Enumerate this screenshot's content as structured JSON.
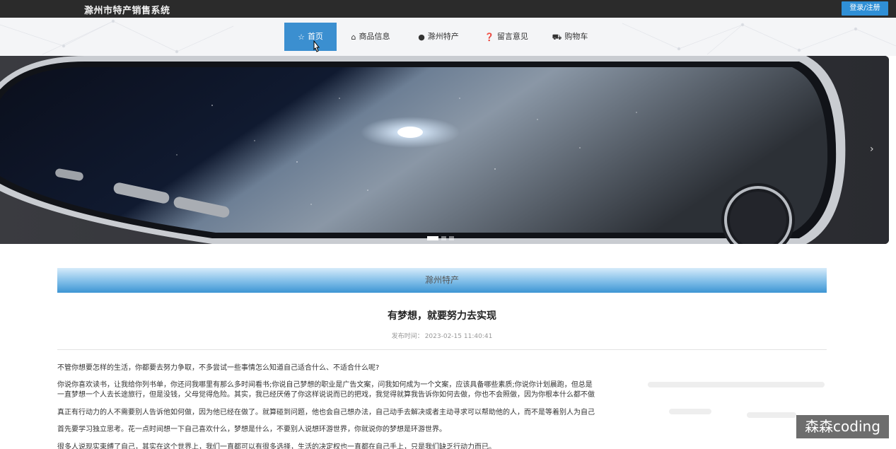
{
  "header": {
    "site_title": "滁州市特产销售系统",
    "login_label": "登录/注册"
  },
  "nav": {
    "items": [
      {
        "label": "首页",
        "icon": "star-icon",
        "active": true
      },
      {
        "label": "商品信息",
        "icon": "bag-icon",
        "active": false
      },
      {
        "label": "滁州特产",
        "icon": "info-icon",
        "active": false
      },
      {
        "label": "留言意见",
        "icon": "question-icon",
        "active": false
      },
      {
        "label": "购物车",
        "icon": "cart-icon",
        "active": false
      }
    ]
  },
  "banner": {
    "next_glyph": "›",
    "slide_count": 3,
    "active_slide": 1
  },
  "section": {
    "title": "滁州特产"
  },
  "article": {
    "title": "有梦想，就要努力去实现",
    "meta_label": "发布时间：",
    "published": "2023-02-15 11:40:41",
    "paragraphs": [
      "不管你想要怎样的生活，你都要去努力争取，不多尝试一些事情怎么知道自己适合什么、不适合什么呢?",
      "你说你喜欢读书，让我给你列书单，你还问我哪里有那么多时间看书;你说自己梦想的职业是广告文案，问我如何成为一个文案，应该具备哪些素质;你说你计划晨跑，但总是",
      "一直梦想一个人去长途旅行，但是没钱，父母觉得危险。其实，我已经厌倦了你这样说说而已的把戏，我觉得就算我告诉你如何去做，你也不会照做，因为你根本什么都不做",
      "真正有行动力的人不需要别人告诉他如何做，因为他已经在做了。就算碰到问题，他也会自己想办法，自己动手去解决或者主动寻求可以帮助他的人，而不是等着别人为自己",
      "首先要学习独立思考。花一点时间想一下自己喜欢什么，梦想是什么，不要别人说想环游世界，你就说你的梦想是环游世界。",
      "很多人说现实束缚了自己，其实在这个世界上，我们一直都可以有很多选择，生活的决定权也一直都在自己手上，只是我们缺乏行动力而已。"
    ]
  },
  "watermark": {
    "text": "森森coding"
  },
  "colors": {
    "topbar": "#2b2b2b",
    "accent": "#3b8fd0",
    "login": "#2f8fd6"
  }
}
